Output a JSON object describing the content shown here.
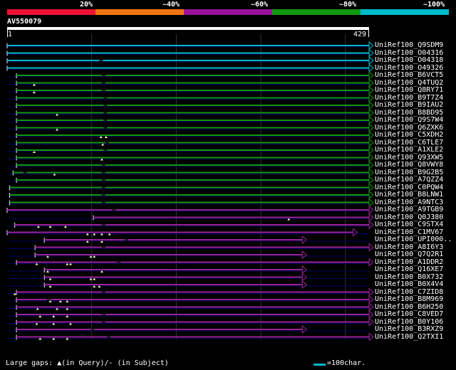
{
  "header": {
    "pct_labels": [
      "20%",
      "~40%",
      "~60%",
      "~80%",
      "~100%"
    ],
    "scale_colors": [
      "#ee1133",
      "#ee7711",
      "#991199",
      "#119911",
      "#00bbcc"
    ]
  },
  "query": {
    "id": "AV550079",
    "start": "1",
    "end": "429",
    "length": 429
  },
  "colors": {
    "cyan": "#00bbcc",
    "green": "#119911",
    "purple": "#992299",
    "marker": "#ffffaa",
    "grid": "#333333",
    "thin_line": "#000066"
  },
  "hits": [
    {
      "name": "UniRef100_Q9SDM9",
      "color": "cyan",
      "start": 1,
      "end": 429,
      "full": true,
      "gaps": [],
      "sgaps": []
    },
    {
      "name": "UniRef100_O04316",
      "color": "cyan",
      "start": 1,
      "end": 429,
      "full": true,
      "gaps": [],
      "sgaps": []
    },
    {
      "name": "UniRef100_O04318",
      "color": "cyan",
      "start": 1,
      "end": 429,
      "full": true,
      "gaps": [],
      "sgaps": [
        110
      ]
    },
    {
      "name": "UniRef100_O49326",
      "color": "cyan",
      "start": 1,
      "end": 429,
      "full": true,
      "gaps": [],
      "sgaps": []
    },
    {
      "name": "UniRef100_B6VCT5",
      "color": "green",
      "start": 12,
      "end": 429,
      "full": true,
      "gaps": [],
      "sgaps": [
        113
      ]
    },
    {
      "name": "UniRef100_Q4TUQ2",
      "color": "green",
      "start": 12,
      "end": 429,
      "full": true,
      "gaps": [
        33
      ],
      "sgaps": [
        113
      ]
    },
    {
      "name": "UniRef100_Q8RY71",
      "color": "green",
      "start": 12,
      "end": 429,
      "full": true,
      "gaps": [
        33
      ],
      "sgaps": [
        113
      ]
    },
    {
      "name": "UniRef100_B9T7Z4",
      "color": "green",
      "start": 12,
      "end": 429,
      "full": true,
      "gaps": [],
      "sgaps": [
        115
      ]
    },
    {
      "name": "UniRef100_B9IAU2",
      "color": "green",
      "start": 12,
      "end": 429,
      "full": true,
      "gaps": [],
      "sgaps": [
        115
      ]
    },
    {
      "name": "UniRef100_B8BD95",
      "color": "green",
      "start": 12,
      "end": 429,
      "full": true,
      "gaps": [
        60
      ],
      "sgaps": [
        115
      ]
    },
    {
      "name": "UniRef100_Q9S7W4",
      "color": "green",
      "start": 12,
      "end": 429,
      "full": true,
      "gaps": [],
      "sgaps": [
        115
      ]
    },
    {
      "name": "UniRef100_Q6ZXK6",
      "color": "green",
      "start": 12,
      "end": 429,
      "full": true,
      "gaps": [
        60
      ],
      "sgaps": [
        115
      ]
    },
    {
      "name": "UniRef100_C5XDH2",
      "color": "green",
      "start": 12,
      "end": 429,
      "full": true,
      "gaps": [
        112,
        118
      ],
      "sgaps": []
    },
    {
      "name": "UniRef100_C6TLE7",
      "color": "green",
      "start": 12,
      "end": 429,
      "full": true,
      "gaps": [
        114
      ],
      "sgaps": [
        117
      ]
    },
    {
      "name": "UniRef100_A1XLE2",
      "color": "green",
      "start": 12,
      "end": 429,
      "full": true,
      "gaps": [
        33
      ],
      "sgaps": [
        115
      ]
    },
    {
      "name": "UniRef100_Q93XW5",
      "color": "green",
      "start": 12,
      "end": 429,
      "full": true,
      "gaps": [
        113
      ],
      "sgaps": []
    },
    {
      "name": "UniRef100_Q8VWY8",
      "color": "green",
      "start": 12,
      "end": 429,
      "full": true,
      "gaps": [],
      "sgaps": [
        113
      ]
    },
    {
      "name": "UniRef100_B9G2B5",
      "color": "green",
      "start": 8,
      "end": 429,
      "full": true,
      "gaps": [
        57
      ],
      "sgaps": [
        20,
        113
      ]
    },
    {
      "name": "UniRef100_A7QZZ4",
      "color": "green",
      "start": 12,
      "end": 429,
      "full": true,
      "gaps": [],
      "sgaps": [
        113
      ]
    },
    {
      "name": "UniRef100_C0PQW4",
      "color": "green",
      "start": 4,
      "end": 429,
      "full": true,
      "gaps": [],
      "sgaps": [
        113
      ]
    },
    {
      "name": "UniRef100_B8LNW1",
      "color": "green",
      "start": 4,
      "end": 429,
      "full": true,
      "gaps": [],
      "sgaps": [
        113
      ]
    },
    {
      "name": "UniRef100_A9NTC3",
      "color": "green",
      "start": 4,
      "end": 429,
      "full": true,
      "gaps": [],
      "sgaps": [
        113
      ]
    },
    {
      "name": "UniRef100_A9TGB9",
      "color": "purple",
      "start": 1,
      "end": 429,
      "full": true,
      "gaps": [],
      "sgaps": [
        125
      ]
    },
    {
      "name": "UniRef100_Q0J380",
      "color": "purple",
      "start": 103,
      "end": 429,
      "full": true,
      "gaps": [
        334
      ],
      "sgaps": []
    },
    {
      "name": "UniRef100_C9STX4",
      "color": "purple",
      "start": 10,
      "end": 429,
      "full": true,
      "gaps": [
        38,
        52,
        70
      ],
      "sgaps": [
        113
      ]
    },
    {
      "name": "UniRef100_C1MV67",
      "color": "purple",
      "start": 1,
      "end": 410,
      "full": true,
      "gaps": [
        96,
        104,
        113,
        122
      ],
      "sgaps": []
    },
    {
      "name": "UniRef100_UPI000..",
      "color": "purple",
      "start": 45,
      "end": 350,
      "full": true,
      "gaps": [
        96,
        113
      ],
      "sgaps": [
        140
      ]
    },
    {
      "name": "UniRef100_A8I6Y3",
      "color": "purple",
      "start": 34,
      "end": 429,
      "full": true,
      "gaps": [],
      "sgaps": [
        113
      ]
    },
    {
      "name": "UniRef100_Q7Q2R1",
      "color": "purple",
      "start": 34,
      "end": 350,
      "full": true,
      "gaps": [
        49,
        100,
        104
      ],
      "sgaps": []
    },
    {
      "name": "UniRef100_A1DDR2",
      "color": "purple",
      "start": 12,
      "end": 429,
      "full": true,
      "gaps": [
        36,
        72,
        76
      ],
      "sgaps": [
        131
      ]
    },
    {
      "name": "UniRef100_Q16XE7",
      "color": "purple",
      "start": 45,
      "end": 350,
      "full": true,
      "gaps": [
        49,
        113
      ],
      "sgaps": []
    },
    {
      "name": "UniRef100_B0X732",
      "color": "purple",
      "start": 45,
      "end": 350,
      "full": true,
      "gaps": [
        52,
        100,
        104
      ],
      "sgaps": []
    },
    {
      "name": "UniRef100_B0X4V4",
      "color": "purple",
      "start": 45,
      "end": 350,
      "full": true,
      "gaps": [
        52,
        104,
        110
      ],
      "sgaps": []
    },
    {
      "name": "UniRef100_C7ZID8",
      "color": "purple",
      "start": 12,
      "end": 429,
      "full": true,
      "gaps": [
        10
      ],
      "sgaps": [
        113
      ]
    },
    {
      "name": "UniRef100_B8M969",
      "color": "purple",
      "start": 12,
      "end": 429,
      "full": true,
      "gaps": [
        52,
        64,
        72
      ],
      "sgaps": [
        48
      ]
    },
    {
      "name": "UniRef100_B6H250",
      "color": "purple",
      "start": 12,
      "end": 429,
      "full": true,
      "gaps": [
        37,
        60,
        72
      ],
      "sgaps": []
    },
    {
      "name": "UniRef100_C8VED7",
      "color": "purple",
      "start": 12,
      "end": 429,
      "full": true,
      "gaps": [
        40,
        56,
        72
      ],
      "sgaps": [
        113
      ]
    },
    {
      "name": "UniRef100_B0Y106",
      "color": "purple",
      "start": 12,
      "end": 429,
      "full": true,
      "gaps": [
        36,
        56,
        76
      ],
      "sgaps": [
        113
      ]
    },
    {
      "name": "UniRef100_B3RXZ9",
      "color": "purple",
      "start": 12,
      "end": 350,
      "full": true,
      "gaps": [],
      "sgaps": [
        100
      ]
    },
    {
      "name": "UniRef100_Q2TXI1",
      "color": "purple",
      "start": 12,
      "end": 429,
      "full": true,
      "gaps": [
        40,
        56,
        72
      ],
      "sgaps": [
        119
      ]
    }
  ],
  "legend": {
    "text": "Large gaps: ▲(in Query)/- (in Subject)",
    "scale_text": "=100char."
  }
}
